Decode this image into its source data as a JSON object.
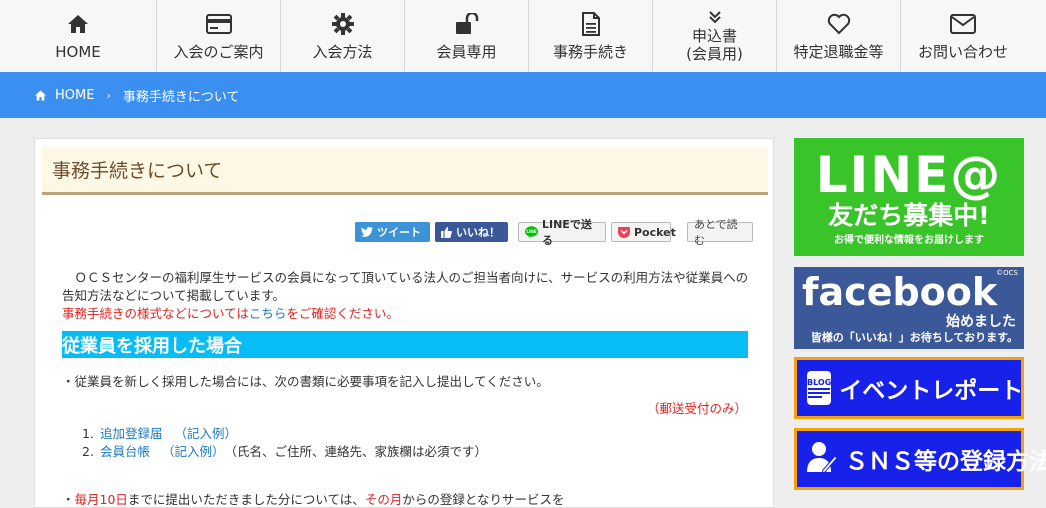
{
  "nav": {
    "items": [
      {
        "label": "HOME",
        "icon": "home-icon"
      },
      {
        "label": "入会のご案内",
        "icon": "card-icon"
      },
      {
        "label": "入会方法",
        "icon": "gear-icon"
      },
      {
        "label": "会員専用",
        "icon": "unlock-icon"
      },
      {
        "label": "事務手続き",
        "icon": "document-icon"
      },
      {
        "label": "申込書",
        "label2": "(会員用)",
        "icon": "chevron-double-down-icon"
      },
      {
        "label": "特定退職金等",
        "icon": "heart-icon"
      },
      {
        "label": "お問い合わせ",
        "icon": "mail-icon"
      }
    ]
  },
  "breadcrumb": {
    "home": "HOME",
    "separator": "›",
    "current": "事務手続きについて"
  },
  "page": {
    "title": "事務手続きについて"
  },
  "share": {
    "tweet": "ツイート",
    "like": "いいね！",
    "line": "LINEで送る",
    "pocket": "Pocket",
    "later": "あとで読む"
  },
  "intro": {
    "line1": "　ＯＣＳセンターの福利厚生サービスの会員になって頂いている法人のご担当者向けに、サービスの利用方法や従業員への告知方法などについて掲載しています。",
    "red_prefix": "事務手続きの様式などについては",
    "link": "こちら",
    "red_suffix": "をご確認ください。"
  },
  "section": {
    "heading": "従業員を採用した場合",
    "paragraph": "・従業員を新しく採用した場合には、次の書類に必要事項を記入し提出してください。",
    "mail_note": "（郵送受付のみ）",
    "list": [
      {
        "num": "1.",
        "name": "追加登録届",
        "example": "（記入例）",
        "note": ""
      },
      {
        "num": "2.",
        "name": "会員台帳",
        "example": "（記入例）",
        "note": "（氏名、ご住所、連絡先、家族欄は必須です）"
      }
    ],
    "cut_prefix": "・",
    "cut_red1": "毎月10日",
    "cut_mid": "までに提出いただきました分については、",
    "cut_red2": "その月",
    "cut_end": "からの登録となりサービスを"
  },
  "sidebar": {
    "line_banner": {
      "big": "LINE@",
      "mid": "友だち募集中!",
      "small": "お得で便利な情報をお届けします"
    },
    "fb_banner": {
      "big": "facebook",
      "ocs": "©OCS",
      "m1": "始めました",
      "m2": "皆様の「いいね！」お待ちしております。"
    },
    "event_banner": {
      "icon_text": "BLOG",
      "text": "イベントレポート"
    },
    "sns_banner": {
      "text": "ＳＮＳ等の登録方法"
    }
  },
  "colors": {
    "breadcrumb_bg": "#3b8ff0",
    "section_bg": "#08bdf6",
    "title_bg": "#fdf7e6",
    "line_green": "#39c52a",
    "facebook_blue": "#3b5998",
    "banner_blue": "#1721ea",
    "banner_border": "#f5a10a"
  }
}
